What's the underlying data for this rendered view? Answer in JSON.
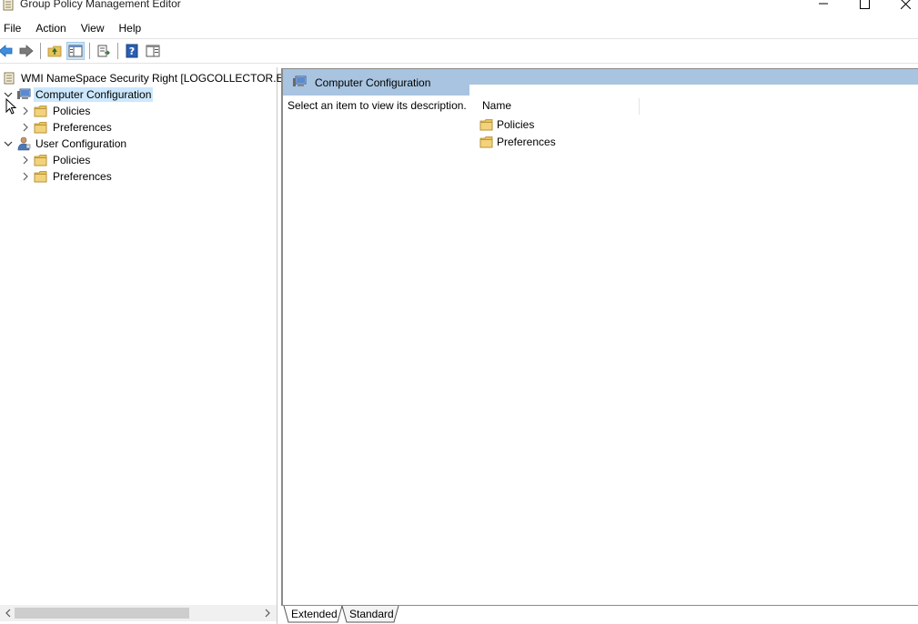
{
  "window": {
    "title": "Group Policy Management Editor"
  },
  "menu": {
    "items": [
      "File",
      "Action",
      "View",
      "Help"
    ]
  },
  "toolbar": {
    "buttons": [
      "back-arrow-icon",
      "forward-arrow-icon",
      "up-folder-icon",
      "show-hide-tree-icon",
      "export-list-icon",
      "help-icon",
      "properties-pane-icon"
    ]
  },
  "tree": {
    "root": "WMI NameSpace Security Right [LOGCOLLECTOR.EL/",
    "computer_config": "Computer Configuration",
    "computer_policies": "Policies",
    "computer_preferences": "Preferences",
    "user_config": "User Configuration",
    "user_policies": "Policies",
    "user_preferences": "Preferences"
  },
  "details": {
    "header_title": "Computer Configuration",
    "description": "Select an item to view its description.",
    "column_name": "Name",
    "items": [
      "Policies",
      "Preferences"
    ]
  },
  "tabs": {
    "extended": "Extended",
    "standard": "Standard"
  },
  "colors": {
    "header_blue": "#a8c4e0",
    "selection": "#cce8ff",
    "folder": "#e8c25a"
  }
}
